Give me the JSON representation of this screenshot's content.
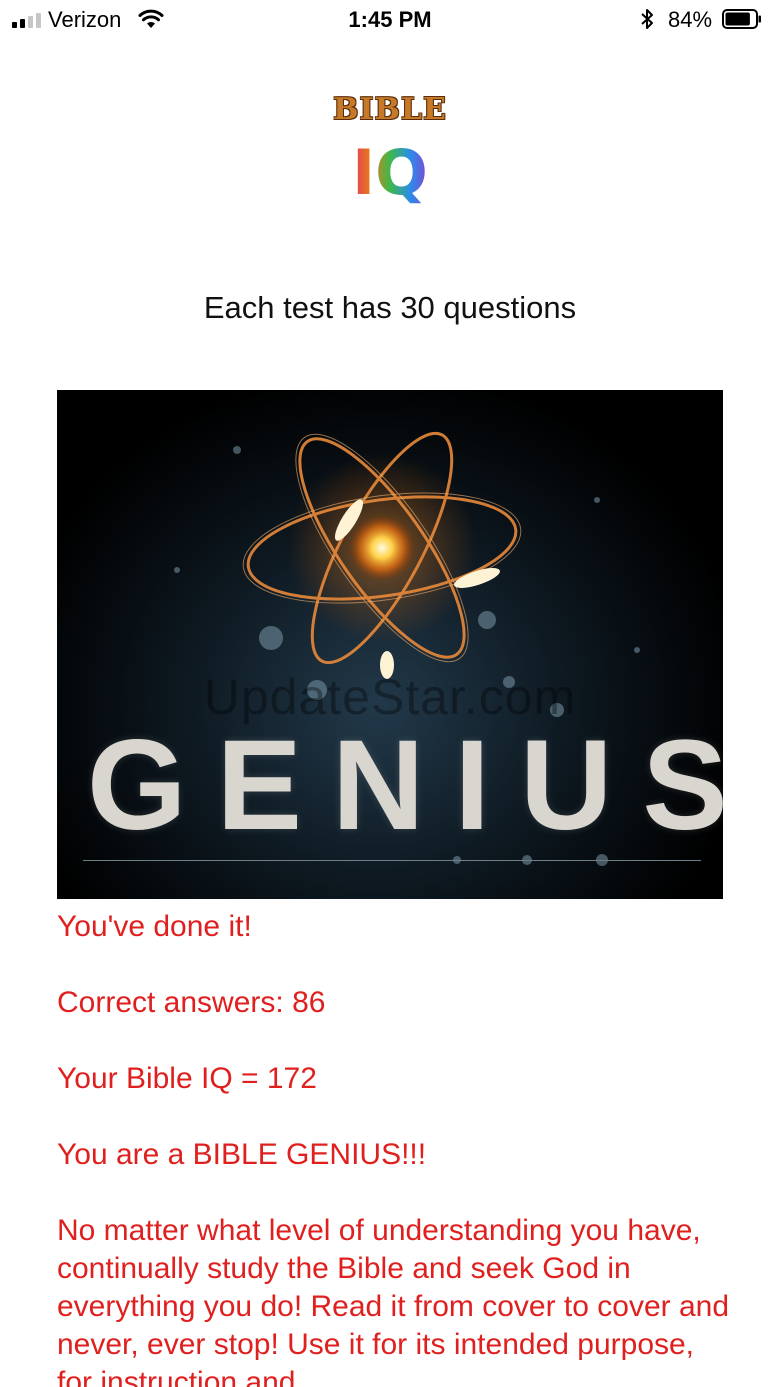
{
  "status_bar": {
    "carrier": "Verizon",
    "time": "1:45 PM",
    "battery_percent": "84%",
    "battery_level": 0.84,
    "signal_bars_filled": 2,
    "signal_bars_total": 4,
    "icons": [
      "signal-icon",
      "wifi-icon",
      "bluetooth-icon",
      "battery-icon"
    ]
  },
  "logo": {
    "word": "BIBLE",
    "mark": "IQ"
  },
  "intro": {
    "text": "Each test has 30 questions"
  },
  "hero": {
    "title": "GENIUS",
    "watermark": "UpdateStar.com"
  },
  "results": {
    "line1": "You've done it!",
    "line2": "Correct answers: 86",
    "line3": "Your Bible IQ = 172",
    "line4": "You are a BIBLE GENIUS!!!",
    "message": "No matter what level of understanding you have, continually study the Bible and seek God in everything you do! Read it from cover to cover and never, ever stop! Use it for its intended purpose, for instruction and"
  },
  "colors": {
    "result_text": "#e0201f",
    "background": "#ffffff"
  }
}
